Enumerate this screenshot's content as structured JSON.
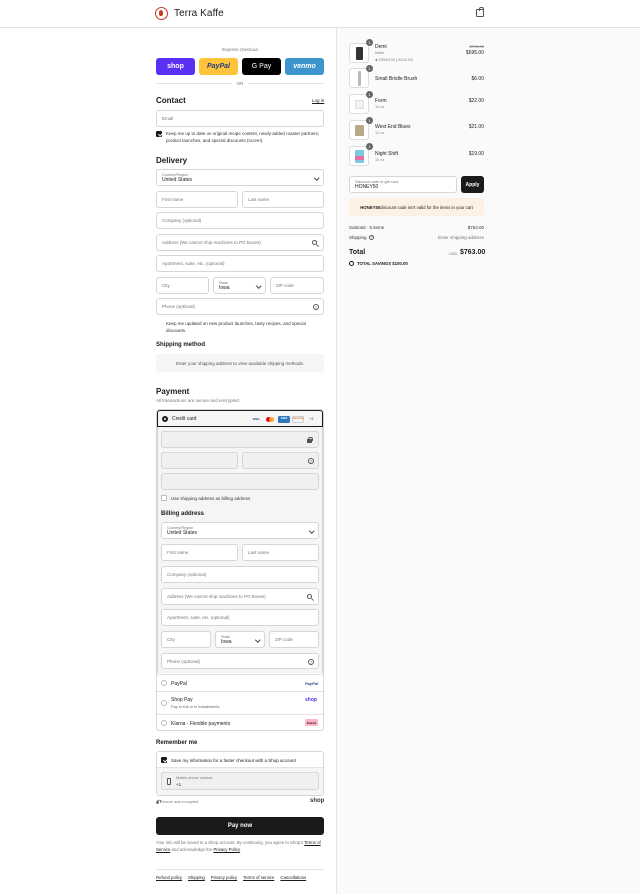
{
  "brand": {
    "name": "Terra Kaffe"
  },
  "express": {
    "title": "Express checkout",
    "or": "OR",
    "buttons": [
      {
        "label": "shop",
        "color": "#5a31f4"
      },
      {
        "label": "PayPal",
        "color": "#ffc439"
      },
      {
        "label": "G Pay",
        "color": "#000000"
      },
      {
        "label": "venmo",
        "color": "#3d95ce"
      }
    ]
  },
  "contact": {
    "heading": "Contact",
    "login_link": "Log in",
    "email_placeholder": "Email",
    "marketing_text": "Keep me up to date on original recipe content, newly-added roaster partners, product launches, and special discounts (score!)."
  },
  "delivery": {
    "heading": "Delivery",
    "country_label": "Country/Region",
    "country_value": "United States",
    "first_name": "First name",
    "last_name": "Last name",
    "company": "Company (optional)",
    "address": "Address (We cannot ship machines to PO Boxes)",
    "apartment": "Apartment, suite, etc. (optional)",
    "city": "City",
    "state_label": "State",
    "state_value": "Iowa",
    "zip": "ZIP code",
    "phone": "Phone (optional)",
    "sms_text": "Keep me updated on new product launches, tasty recipes, and special discounts."
  },
  "shipping": {
    "heading": "Shipping method",
    "notice": "Enter your shipping address to view available shipping methods."
  },
  "payment": {
    "heading": "Payment",
    "subtitle": "All transactions are secure and encrypted.",
    "credit_card_label": "Credit card",
    "card_brands": [
      "VISA",
      "MC",
      "AMEX",
      "DISCOVER"
    ],
    "more_cards": "+4",
    "use_shipping_as_billing": "Use shipping address as billing address",
    "billing_heading": "Billing address",
    "paypal_label": "PayPal",
    "shoppay_label": "Shop Pay",
    "shoppay_sub": "Pay in full or in installments",
    "klarna_label": "Klarna - Flexible payments",
    "paypal_logo": "PayPal",
    "shop_logo": "shop",
    "klarna_logo": "Klarna"
  },
  "remember": {
    "heading": "Remember me",
    "save_text": "Save my information for a faster checkout with a Shop account",
    "mobile_label": "Mobile phone number",
    "mobile_value": "+1",
    "secure_text": "Secure and encrypted",
    "shop_logo": "shop"
  },
  "pay_button": "Pay now",
  "legal": {
    "text1": "Your info will be saved to a Shop account. By continuing, you agree to Shop's",
    "terms": "Terms of Service",
    "text2": "and acknowledge the",
    "privacy": "Privacy Policy",
    "text3": "."
  },
  "footer_links": [
    "Refund policy",
    "Shipping",
    "Privacy policy",
    "Terms of service",
    "Cancellations"
  ],
  "summary": {
    "items": [
      {
        "qty": "1",
        "name": "Demi",
        "sub": "Matte",
        "discount": "DEMI100 (-$100.00)",
        "old_price": "$795.00",
        "price": "$695.00"
      },
      {
        "qty": "1",
        "name": "Small Bristle Brush",
        "sub": "",
        "price": "$6.00"
      },
      {
        "qty": "1",
        "name": "Form",
        "sub": "10 oz",
        "price": "$22.00"
      },
      {
        "qty": "1",
        "name": "West End Blues",
        "sub": "12 oz",
        "price": "$21.00"
      },
      {
        "qty": "1",
        "name": "Night Shift",
        "sub": "10 oz",
        "price": "$19.00"
      }
    ],
    "discount_label": "Discount code or gift card",
    "discount_value": "HONEY50",
    "apply": "Apply",
    "discount_error_code": "HONEY50",
    "discount_error_rest": " discount code isn't valid for the items in your cart",
    "subtotal_label": "Subtotal · 5 items",
    "subtotal_value": "$763.00",
    "shipping_label": "Shipping",
    "shipping_value": "Enter shipping address",
    "total_label": "Total",
    "currency": "USD",
    "total_value": "$763.00",
    "savings_label": "TOTAL SAVINGS",
    "savings_value": "$100.00"
  }
}
